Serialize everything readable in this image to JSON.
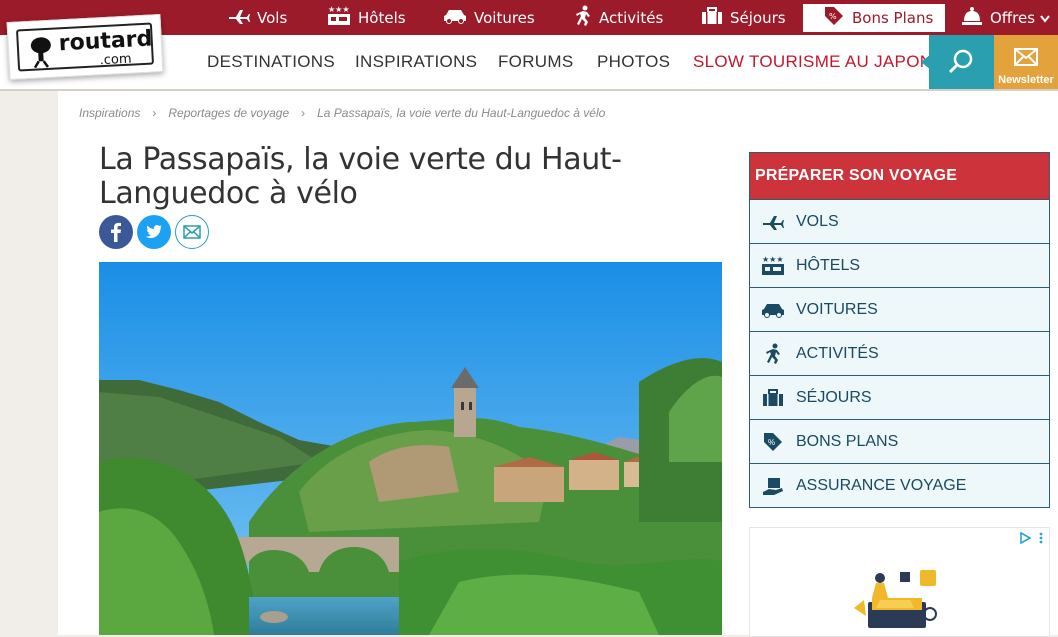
{
  "top_nav": [
    {
      "label": "Vols",
      "icon": "plane-icon"
    },
    {
      "label": "Hôtels",
      "icon": "hotel-icon"
    },
    {
      "label": "Voitures",
      "icon": "car-icon"
    },
    {
      "label": "Activités",
      "icon": "activity-icon"
    },
    {
      "label": "Séjours",
      "icon": "suitcase-icon"
    },
    {
      "label": "Bons Plans",
      "icon": "tag-icon",
      "active": true
    },
    {
      "label": "Offres",
      "icon": "bell-icon"
    }
  ],
  "logo": {
    "main": "routard",
    "suffix": ".com"
  },
  "main_nav": [
    {
      "label": "DESTINATIONS"
    },
    {
      "label": "INSPIRATIONS"
    },
    {
      "label": "FORUMS"
    },
    {
      "label": "PHOTOS"
    },
    {
      "label": "SLOW TOURISME AU JAPON",
      "highlight": true
    }
  ],
  "newsletter_label": "Newsletter",
  "breadcrumb": [
    "Inspirations",
    "Reportages de voyage",
    "La Passapaïs, la voie verte du Haut-Languedoc à vélo"
  ],
  "article": {
    "title": "La Passapaïs, la voie verte du Haut-Languedoc à vélo"
  },
  "sidebar": {
    "title": "PRÉPARER SON VOYAGE",
    "items": [
      {
        "label": "VOLS",
        "icon": "plane-icon"
      },
      {
        "label": "HÔTELS",
        "icon": "hotel-icon"
      },
      {
        "label": "VOITURES",
        "icon": "car-icon"
      },
      {
        "label": "ACTIVITÉS",
        "icon": "activity-icon"
      },
      {
        "label": "SÉJOURS",
        "icon": "suitcase-icon"
      },
      {
        "label": "BONS PLANS",
        "icon": "tag-icon"
      },
      {
        "label": "ASSURANCE VOYAGE",
        "icon": "insurance-icon"
      }
    ]
  },
  "colors": {
    "brand": "#9c1b2a",
    "accent": "#2a9fb0",
    "newsletter": "#e3a23b",
    "promo": "#c5162c",
    "sidebar_head": "#cc333a",
    "sidebar_text": "#1b4a63"
  }
}
